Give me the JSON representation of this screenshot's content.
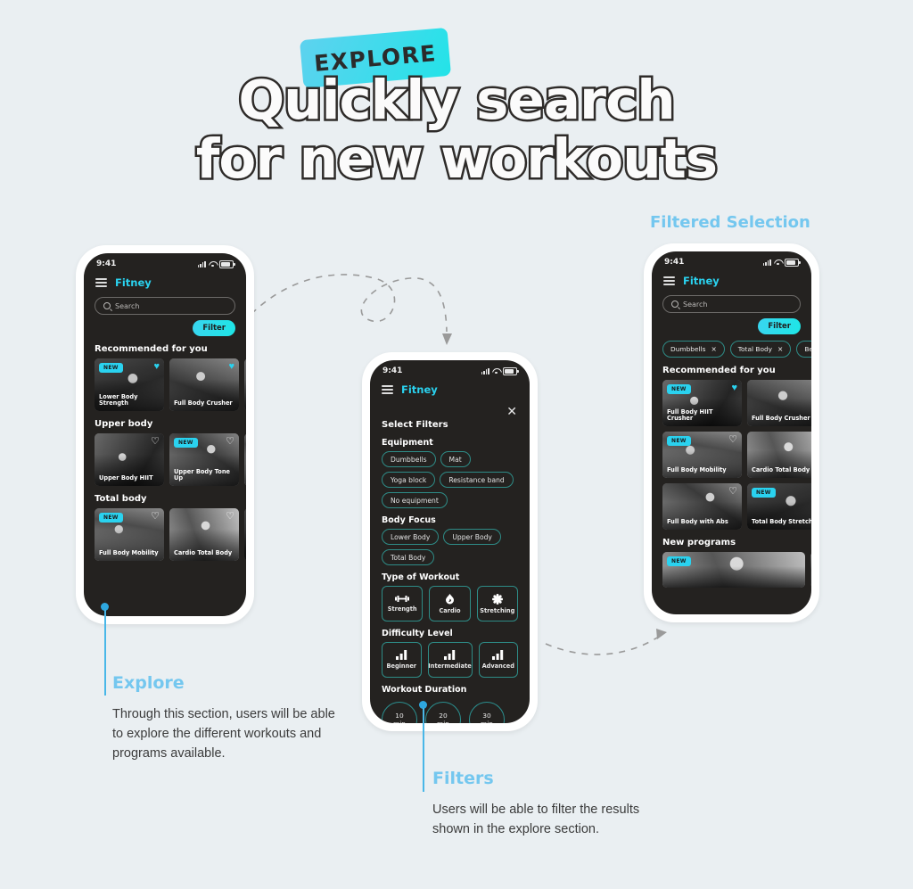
{
  "header": {
    "badge": "EXPLORE",
    "title_line1": "Quickly search",
    "title_line2": "for new workouts",
    "badge_color": "#2ad2ef"
  },
  "labels": {
    "filtered_selection": "Filtered Selection"
  },
  "annotations": [
    {
      "heading": "Explore",
      "body": "Through this section, users will be able to explore the different workouts and programs available.",
      "color": "#74c7ef"
    },
    {
      "heading": "Filters",
      "body": "Users will be able to filter the results shown in the explore section.",
      "color": "#74c7ef"
    }
  ],
  "phone1": {
    "status": {
      "time": "9:41",
      "icons": [
        "signal-icon",
        "wifi-icon",
        "battery-icon"
      ]
    },
    "brand": "Fitney",
    "menu_icon": "hamburger-icon",
    "search": {
      "placeholder": "Search",
      "icon": "search-icon"
    },
    "filter_button": "Filter",
    "sections": [
      {
        "title": "Recommended for you",
        "cards": [
          {
            "name": "Lower Body Strength",
            "badge": "NEW",
            "favorite": true
          },
          {
            "name": "Full Body Crusher",
            "badge": "",
            "favorite": true
          }
        ]
      },
      {
        "title": "Upper body",
        "cards": [
          {
            "name": "Upper Body HIIT",
            "badge": "",
            "favorite": false
          },
          {
            "name": "Upper Body Tone Up",
            "badge": "NEW",
            "favorite": false
          }
        ]
      },
      {
        "title": "Total body",
        "cards": [
          {
            "name": "Full Body Mobility",
            "badge": "NEW",
            "favorite": false
          },
          {
            "name": "Cardio Total Body",
            "badge": "",
            "favorite": false
          }
        ]
      }
    ]
  },
  "phone2": {
    "status": {
      "time": "9:41"
    },
    "brand": "Fitney",
    "close_icon": "close-icon",
    "title": "Select Filters",
    "groups": [
      {
        "label": "Equipment",
        "chips": [
          "Dumbbells",
          "Mat",
          "Yoga block",
          "Resistance band",
          "No equipment"
        ]
      },
      {
        "label": "Body Focus",
        "chips": [
          "Lower Body",
          "Upper Body",
          "Total Body"
        ]
      }
    ],
    "type_of_workout": {
      "label": "Type of Workout",
      "options": [
        {
          "label": "Strength",
          "icon": "dumbbell-icon"
        },
        {
          "label": "Cardio",
          "icon": "flame-icon"
        },
        {
          "label": "Stretching",
          "icon": "stretch-icon"
        }
      ]
    },
    "difficulty": {
      "label": "Difficulty Level",
      "options": [
        {
          "label": "Beginner",
          "icon": "bars-icon"
        },
        {
          "label": "Intermediate",
          "icon": "bars-icon"
        },
        {
          "label": "Advanced",
          "icon": "bars-icon"
        }
      ]
    },
    "duration": {
      "label": "Workout Duration",
      "options": [
        {
          "value": "10",
          "unit": "min"
        },
        {
          "value": "20",
          "unit": "min"
        },
        {
          "value": "30",
          "unit": "min"
        }
      ]
    }
  },
  "phone3": {
    "status": {
      "time": "9:41"
    },
    "brand": "Fitney",
    "search": {
      "placeholder": "Search",
      "icon": "search-icon"
    },
    "filter_button": "Filter",
    "active_filters": [
      {
        "label": "Dumbbells",
        "remove": "×"
      },
      {
        "label": "Total Body",
        "remove": "×"
      },
      {
        "label": "Beg",
        "remove": ""
      }
    ],
    "sections": [
      {
        "title": "Recommended for you",
        "cards": [
          {
            "name": "Full Body HIIT Crusher",
            "badge": "NEW",
            "favorite": true
          },
          {
            "name": "Full Body Crusher",
            "badge": "",
            "favorite": true
          },
          {
            "name": "Full Body Mobility",
            "badge": "NEW",
            "favorite": false
          },
          {
            "name": "Cardio Total Body",
            "badge": "",
            "favorite": false
          },
          {
            "name": "Full Body with Abs",
            "badge": "",
            "favorite": false
          },
          {
            "name": "Total Body Stretch",
            "badge": "NEW",
            "favorite": false
          }
        ]
      },
      {
        "title": "New programs",
        "cards": [
          {
            "name": "",
            "badge": "NEW",
            "favorite": false
          }
        ]
      }
    ]
  }
}
